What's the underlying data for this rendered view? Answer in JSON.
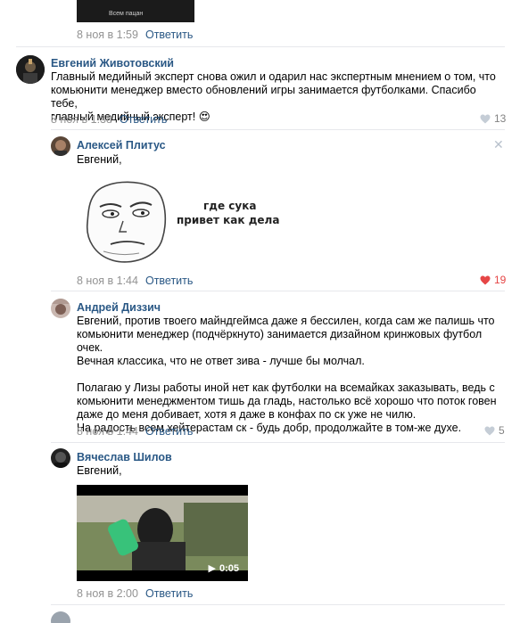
{
  "top": {
    "image_caption": "Всем пацан",
    "date": "8 ноя в 1:59",
    "reply_label": "Ответить"
  },
  "comments": [
    {
      "author": "Евгений Животовский",
      "text": "Главный медийный эксперт снова ожил и одарил нас экспертным мнением о том, что\nкомьюнити менеджер вместо обновлений игры занимается футболками. Спасибо тебе,\nглавный медийный эксперт! 😍",
      "date": "8 ноя в 1:38",
      "reply_label": "Ответить",
      "likes": "13"
    },
    {
      "author": "Алексей Плитус",
      "text": "Евгений,",
      "meme_line1": "где сука",
      "meme_line2": "привет как дела",
      "date": "8 ноя в 1:44",
      "reply_label": "Ответить",
      "likes": "19"
    },
    {
      "author": "Андрей Диззич",
      "text": "Евгений, против твоего майндгеймса даже я бессилен, когда сам же палишь что\nкомьюнити менеджер (подчёркнуто) занимается дизайном кринжовых футбол очек.\nВечная классика, что не ответ зива - лучше бы молчал.\n\nПолагаю у Лизы работы иной нет как футболки на всемайках заказывать, ведь с\nкомьюнити менеджментом тишь да гладь, настолько всё хорошо что поток говен\nдаже до меня добивает, хотя я даже в конфах по ск уже не чилю.\nНа радость всем хейтерастам ск - будь добр, продолжайте в том-же духе.",
      "date": "8 ноя в 1:44",
      "reply_label": "Ответить",
      "likes": "5"
    },
    {
      "author": "Вячеслав Шилов",
      "text": "Евгений,",
      "video_duration": "0:05",
      "date": "8 ноя в 2:00",
      "reply_label": "Ответить"
    }
  ],
  "colors": {
    "link": "#2a5885",
    "meta": "#939393",
    "like_active": "#e64646",
    "like_inactive": "#828282"
  }
}
